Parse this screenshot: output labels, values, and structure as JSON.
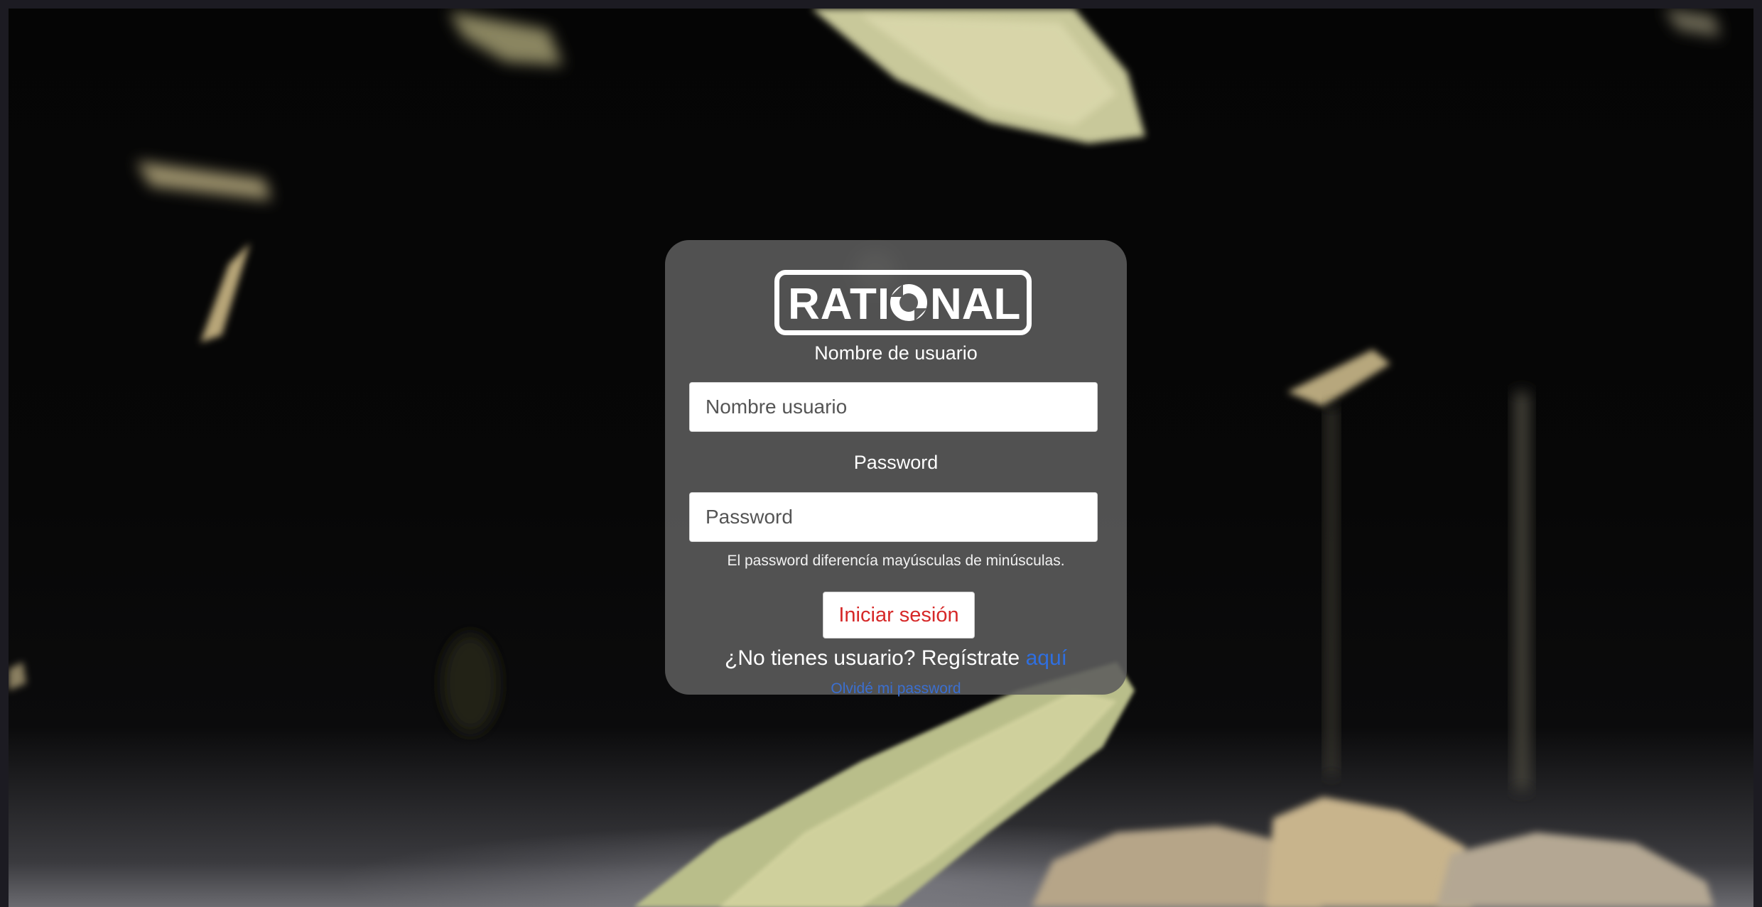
{
  "brand": {
    "logo_text": "RATIONAL",
    "logo_icon": "rational-logo"
  },
  "login": {
    "username_label": "Nombre de usuario",
    "username_placeholder": "Nombre usuario",
    "username_value": "",
    "password_label": "Password",
    "password_placeholder": "Password",
    "password_value": "",
    "case_hint": "El password diferencía mayúsculas de minúsculas.",
    "submit_label": "Iniciar sesión",
    "register_prompt": "¿No tienes usuario? Regístrate",
    "register_link": "aquí",
    "forgot_link": "Olvidé mi password"
  },
  "colors": {
    "card_bg": "#5c5c5c",
    "submit_text": "#d62828",
    "link": "#2f6fe0"
  }
}
